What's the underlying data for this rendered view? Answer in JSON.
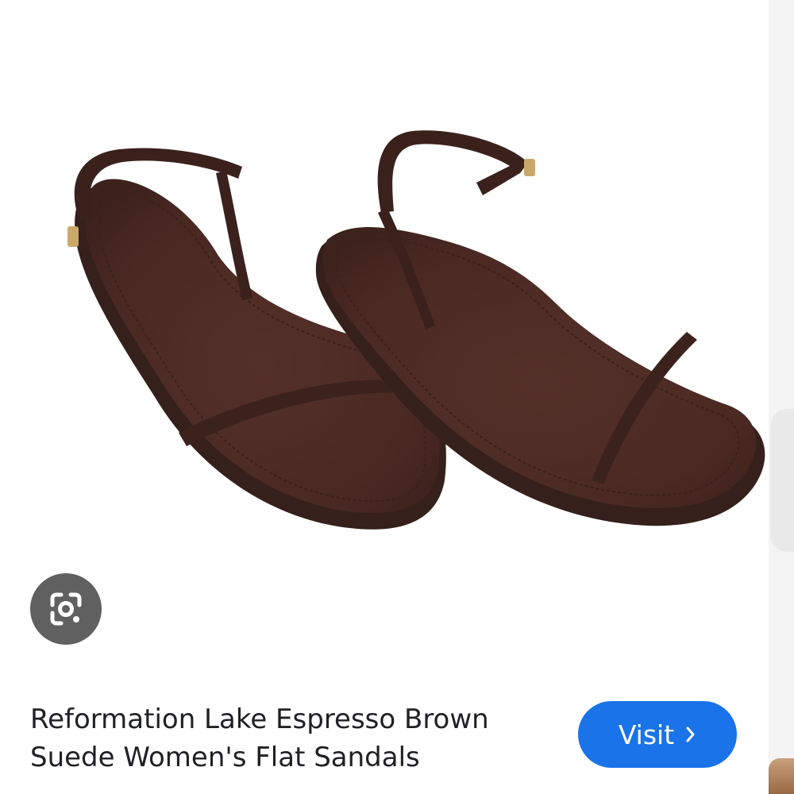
{
  "product": {
    "title_line1": "Reformation Lake Espresso Brown",
    "title_line2": "Suede Women's Flat Sandals",
    "image_icon": "espresso-brown-suede-flat-sandals",
    "image_color": "#4a2a22"
  },
  "lens": {
    "icon": "google-lens-icon"
  },
  "visit": {
    "label": "Visit",
    "icon": "chevron-right-icon",
    "color": "#1a73e8"
  }
}
